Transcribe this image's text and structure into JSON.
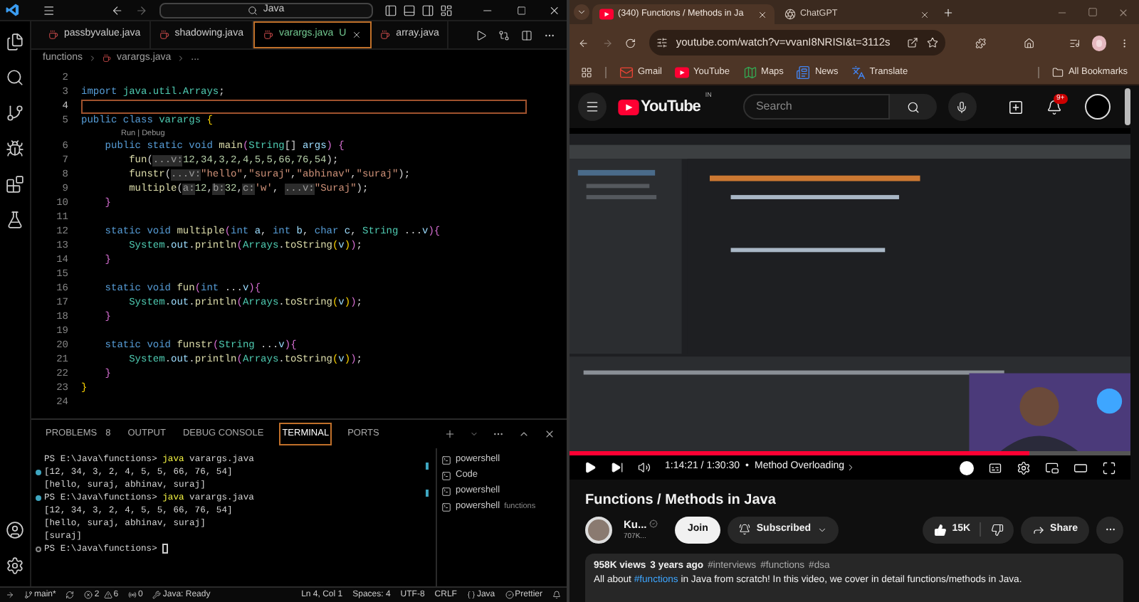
{
  "vscode": {
    "search": "Java",
    "tabs": [
      {
        "label": "passbyvalue.java",
        "selected": false
      },
      {
        "label": "shadowing.java",
        "selected": false
      },
      {
        "label": "varargs.java",
        "badge": "U",
        "selected": true
      },
      {
        "label": "array.java",
        "selected": false
      }
    ],
    "breadcrumb": [
      "functions",
      "varargs.java",
      "..."
    ],
    "code": [
      {
        "kind": "line",
        "number": "2",
        "current": false
      },
      {
        "kind": "line",
        "number": "3",
        "current": false,
        "segments": [
          {
            "kind": "kw",
            "text": "import "
          },
          {
            "kind": "type",
            "text": "java.util.Arrays"
          },
          {
            "kind": "plain",
            "text": ";"
          }
        ]
      },
      {
        "kind": "line",
        "number": "4",
        "current": true
      },
      {
        "kind": "line",
        "number": "5",
        "current": false,
        "segments": [
          {
            "kind": "kw",
            "text": "public class "
          },
          {
            "kind": "type",
            "text": "varargs "
          },
          {
            "kind": "brace",
            "text": "{"
          }
        ]
      },
      {
        "kind": "lens",
        "text": "Run | Debug"
      },
      {
        "kind": "line",
        "number": "6",
        "current": false,
        "segments": [
          {
            "kind": "kw",
            "text": "    public static void "
          },
          {
            "kind": "fn",
            "text": "main"
          },
          {
            "kind": "paren",
            "text": "("
          },
          {
            "kind": "type",
            "text": "String"
          },
          {
            "kind": "plain",
            "text": "[] "
          },
          {
            "kind": "var",
            "text": "args"
          },
          {
            "kind": "paren",
            "text": ") {"
          }
        ]
      },
      {
        "kind": "line",
        "number": "7",
        "current": false,
        "segments": [
          {
            "kind": "fn",
            "text": "        fun"
          },
          {
            "kind": "plain",
            "text": "("
          },
          {
            "kind": "hint",
            "text": "...v:"
          },
          {
            "kind": "num",
            "text": "12,34,3,2,4,5,5,66,76,54"
          },
          {
            "kind": "plain",
            "text": ");"
          }
        ]
      },
      {
        "kind": "line",
        "number": "8",
        "current": false,
        "segments": [
          {
            "kind": "fn",
            "text": "        funstr"
          },
          {
            "kind": "plain",
            "text": "("
          },
          {
            "kind": "hint",
            "text": "...v:"
          },
          {
            "kind": "str",
            "text": "\"hello\""
          },
          {
            "kind": "plain",
            "text": ","
          },
          {
            "kind": "str",
            "text": "\"suraj\""
          },
          {
            "kind": "plain",
            "text": ","
          },
          {
            "kind": "str",
            "text": "\"abhinav\""
          },
          {
            "kind": "plain",
            "text": ","
          },
          {
            "kind": "str",
            "text": "\"suraj\""
          },
          {
            "kind": "plain",
            "text": ");"
          }
        ]
      },
      {
        "kind": "line",
        "number": "9",
        "current": false,
        "segments": [
          {
            "kind": "fn",
            "text": "        multiple"
          },
          {
            "kind": "plain",
            "text": "("
          },
          {
            "kind": "hint",
            "text": "a:"
          },
          {
            "kind": "num",
            "text": "12"
          },
          {
            "kind": "plain",
            "text": ","
          },
          {
            "kind": "hint",
            "text": "b:"
          },
          {
            "kind": "num",
            "text": "32"
          },
          {
            "kind": "plain",
            "text": ","
          },
          {
            "kind": "hint",
            "text": "c:"
          },
          {
            "kind": "str",
            "text": "'w'"
          },
          {
            "kind": "plain",
            "text": ", "
          },
          {
            "kind": "hint",
            "text": "...v:"
          },
          {
            "kind": "str",
            "text": "\"Suraj\""
          },
          {
            "kind": "plain",
            "text": ");"
          }
        ]
      },
      {
        "kind": "line",
        "number": "10",
        "current": false,
        "segments": [
          {
            "kind": "paren",
            "text": "    }"
          }
        ]
      },
      {
        "kind": "line",
        "number": "11",
        "current": false
      },
      {
        "kind": "line",
        "number": "12",
        "current": false,
        "segments": [
          {
            "kind": "kw",
            "text": "    static void "
          },
          {
            "kind": "fn",
            "text": "multiple"
          },
          {
            "kind": "paren",
            "text": "("
          },
          {
            "kind": "kw",
            "text": "int "
          },
          {
            "kind": "var",
            "text": "a"
          },
          {
            "kind": "plain",
            "text": ", "
          },
          {
            "kind": "kw",
            "text": "int "
          },
          {
            "kind": "var",
            "text": "b"
          },
          {
            "kind": "plain",
            "text": ", "
          },
          {
            "kind": "kw",
            "text": "char "
          },
          {
            "kind": "var",
            "text": "c"
          },
          {
            "kind": "plain",
            "text": ", "
          },
          {
            "kind": "type",
            "text": "String"
          },
          {
            "kind": "plain",
            "text": " ..."
          },
          {
            "kind": "var",
            "text": "v"
          },
          {
            "kind": "paren",
            "text": "){"
          }
        ]
      },
      {
        "kind": "line",
        "number": "13",
        "current": false,
        "segments": [
          {
            "kind": "type",
            "text": "        System"
          },
          {
            "kind": "plain",
            "text": "."
          },
          {
            "kind": "var",
            "text": "out"
          },
          {
            "kind": "plain",
            "text": "."
          },
          {
            "kind": "fn",
            "text": "println"
          },
          {
            "kind": "paren",
            "text": "("
          },
          {
            "kind": "type",
            "text": "Arrays"
          },
          {
            "kind": "plain",
            "text": "."
          },
          {
            "kind": "fn",
            "text": "toString"
          },
          {
            "kind": "brace",
            "text": "("
          },
          {
            "kind": "var",
            "text": "v"
          },
          {
            "kind": "brace",
            "text": ")"
          },
          {
            "kind": "paren",
            "text": ")"
          },
          {
            "kind": "plain",
            "text": ";"
          }
        ]
      },
      {
        "kind": "line",
        "number": "14",
        "current": false,
        "segments": [
          {
            "kind": "paren",
            "text": "    }"
          }
        ]
      },
      {
        "kind": "line",
        "number": "15",
        "current": false
      },
      {
        "kind": "line",
        "number": "16",
        "current": false,
        "segments": [
          {
            "kind": "kw",
            "text": "    static void "
          },
          {
            "kind": "fn",
            "text": "fun"
          },
          {
            "kind": "paren",
            "text": "("
          },
          {
            "kind": "kw",
            "text": "int"
          },
          {
            "kind": "plain",
            "text": " ..."
          },
          {
            "kind": "var",
            "text": "v"
          },
          {
            "kind": "paren",
            "text": "){"
          }
        ]
      },
      {
        "kind": "line",
        "number": "17",
        "current": false,
        "segments": [
          {
            "kind": "type",
            "text": "        System"
          },
          {
            "kind": "plain",
            "text": "."
          },
          {
            "kind": "var",
            "text": "out"
          },
          {
            "kind": "plain",
            "text": "."
          },
          {
            "kind": "fn",
            "text": "println"
          },
          {
            "kind": "paren",
            "text": "("
          },
          {
            "kind": "type",
            "text": "Arrays"
          },
          {
            "kind": "plain",
            "text": "."
          },
          {
            "kind": "fn",
            "text": "toString"
          },
          {
            "kind": "brace",
            "text": "("
          },
          {
            "kind": "var",
            "text": "v"
          },
          {
            "kind": "brace",
            "text": ")"
          },
          {
            "kind": "paren",
            "text": ")"
          },
          {
            "kind": "plain",
            "text": ";"
          }
        ]
      },
      {
        "kind": "line",
        "number": "18",
        "current": false,
        "segments": [
          {
            "kind": "paren",
            "text": "    }"
          }
        ]
      },
      {
        "kind": "line",
        "number": "19",
        "current": false
      },
      {
        "kind": "line",
        "number": "20",
        "current": false,
        "segments": [
          {
            "kind": "kw",
            "text": "    static void "
          },
          {
            "kind": "fn",
            "text": "funstr"
          },
          {
            "kind": "paren",
            "text": "("
          },
          {
            "kind": "type",
            "text": "String"
          },
          {
            "kind": "plain",
            "text": " ..."
          },
          {
            "kind": "var",
            "text": "v"
          },
          {
            "kind": "paren",
            "text": "){"
          }
        ]
      },
      {
        "kind": "line",
        "number": "21",
        "current": false,
        "segments": [
          {
            "kind": "type",
            "text": "        System"
          },
          {
            "kind": "plain",
            "text": "."
          },
          {
            "kind": "var",
            "text": "out"
          },
          {
            "kind": "plain",
            "text": "."
          },
          {
            "kind": "fn",
            "text": "println"
          },
          {
            "kind": "paren",
            "text": "("
          },
          {
            "kind": "type",
            "text": "Arrays"
          },
          {
            "kind": "plain",
            "text": "."
          },
          {
            "kind": "fn",
            "text": "toString"
          },
          {
            "kind": "brace",
            "text": "("
          },
          {
            "kind": "var",
            "text": "v"
          },
          {
            "kind": "brace",
            "text": ")"
          },
          {
            "kind": "paren",
            "text": ")"
          },
          {
            "kind": "plain",
            "text": ";"
          }
        ]
      },
      {
        "kind": "line",
        "number": "22",
        "current": false,
        "segments": [
          {
            "kind": "paren",
            "text": "    }"
          }
        ]
      },
      {
        "kind": "line",
        "number": "23",
        "current": false,
        "segments": [
          {
            "kind": "brace",
            "text": "}"
          }
        ]
      },
      {
        "kind": "line",
        "number": "24",
        "current": false
      }
    ],
    "panel_tabs": [
      {
        "label": "PROBLEMS",
        "count": "8",
        "selected": false
      },
      {
        "label": "OUTPUT",
        "selected": false
      },
      {
        "label": "DEBUG CONSOLE",
        "selected": false
      },
      {
        "label": "TERMINAL",
        "selected": true
      },
      {
        "label": "PORTS",
        "selected": false
      }
    ],
    "terminal": [
      {
        "done": false,
        "active": false,
        "segments": [
          {
            "kind": "plain",
            "text": "PS E:\\Java\\functions> "
          },
          {
            "kind": "cmd",
            "text": "java"
          },
          {
            "kind": "plain",
            "text": " varargs.java"
          }
        ]
      },
      {
        "done": true,
        "active": false,
        "segments": [
          {
            "kind": "plain",
            "text": "[12, 34, 3, 2, 4, 5, 5, 66, 76, 54]"
          }
        ]
      },
      {
        "done": false,
        "active": false,
        "segments": [
          {
            "kind": "plain",
            "text": "[hello, suraj, abhinav, suraj]"
          }
        ]
      },
      {
        "done": true,
        "active": false,
        "segments": [
          {
            "kind": "plain",
            "text": "PS E:\\Java\\functions> "
          },
          {
            "kind": "cmd",
            "text": "java"
          },
          {
            "kind": "plain",
            "text": " varargs.java"
          }
        ]
      },
      {
        "done": false,
        "active": false,
        "segments": [
          {
            "kind": "plain",
            "text": "[12, 34, 3, 2, 4, 5, 5, 66, 76, 54]"
          }
        ]
      },
      {
        "done": false,
        "active": false,
        "segments": [
          {
            "kind": "plain",
            "text": "[hello, suraj, abhinav, suraj]"
          }
        ]
      },
      {
        "done": false,
        "active": false,
        "segments": [
          {
            "kind": "plain",
            "text": "[suraj]"
          }
        ]
      },
      {
        "done": false,
        "active": true,
        "segments": [
          {
            "kind": "plain",
            "text": "PS E:\\Java\\functions> "
          }
        ]
      }
    ],
    "terminals": [
      {
        "label": "powershell"
      },
      {
        "label": "Code"
      },
      {
        "label": "powershell"
      },
      {
        "label": "powershell",
        "detail": "functions"
      }
    ],
    "status_left": [
      {
        "kind": "branch",
        "text": "main*"
      },
      {
        "kind": "sync"
      },
      {
        "kind": "errors",
        "text": "2"
      },
      {
        "kind": "warnings",
        "text": "6"
      },
      {
        "kind": "ports",
        "text": "0"
      },
      {
        "kind": "java",
        "text": "Java: Ready"
      }
    ],
    "status_right": [
      {
        "kind": "plain",
        "text": "Ln 4, Col 1"
      },
      {
        "kind": "plain",
        "text": "Spaces: 4"
      },
      {
        "kind": "plain",
        "text": "UTF-8"
      },
      {
        "kind": "plain",
        "text": "CRLF"
      },
      {
        "kind": "language",
        "text": "Java"
      },
      {
        "kind": "prettier",
        "text": "Prettier"
      },
      {
        "kind": "bell"
      }
    ]
  },
  "browser": {
    "tabs": [
      {
        "label": "(340) Functions / Methods in Ja",
        "kind": "youtube",
        "selected": true
      },
      {
        "label": "ChatGPT",
        "kind": "chatgpt",
        "selected": false
      }
    ],
    "url": "youtube.com/watch?v=vvanI8NRISI&t=3112s",
    "bookmarks": [
      {
        "label": "Gmail",
        "kind": "gmail"
      },
      {
        "label": "YouTube",
        "kind": "youtube"
      },
      {
        "label": "Maps",
        "kind": "maps"
      },
      {
        "label": "News",
        "kind": "news"
      },
      {
        "label": "Translate",
        "kind": "translate"
      }
    ],
    "all_bookmarks": "All Bookmarks"
  },
  "youtube": {
    "logo": "YouTube",
    "region": "IN",
    "search": {
      "placeholder": "Search"
    },
    "notifications": "9+",
    "player": {
      "level": 0.82,
      "time": "1:14:21 / 1:30:30",
      "separator": "•",
      "chapter": "Method Overloading",
      "autoplay": true
    },
    "title": "Functions / Methods in Java",
    "channel": {
      "name": "Ku...",
      "subscribers": "707K..."
    },
    "join": "Join",
    "subscribe": "Subscribed",
    "likes": "15K",
    "share": "Share",
    "description": {
      "views": "958K views",
      "age": "3 years ago",
      "tags": [
        "#interviews",
        "#functions",
        "#dsa"
      ],
      "before": "All about ",
      "link": "#functions",
      "after": " in Java from scratch! In this video, we cover in detail functions/methods in Java."
    }
  }
}
